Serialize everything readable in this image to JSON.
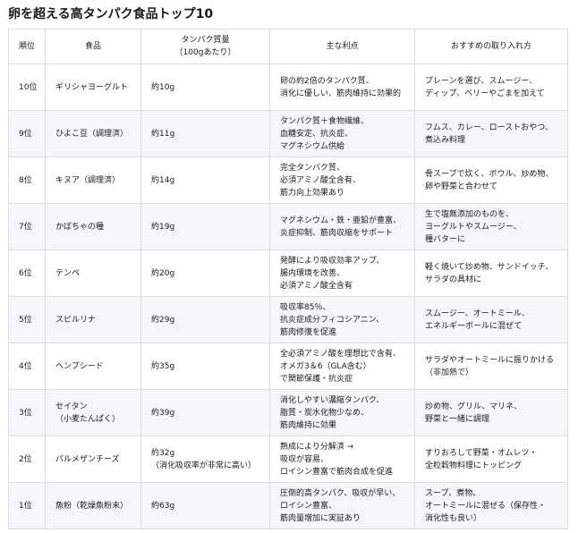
{
  "page": {
    "title": "卵を超える高タンパク食品トップ10"
  },
  "table": {
    "headers": [
      "順位",
      "食品",
      [
        "タンパク質量",
        "（100gあたり）"
      ],
      "主な利点",
      "おすすめの取り入れ方"
    ],
    "rows": [
      {
        "rank": "10位",
        "food": [
          "ギリシャヨーグルト"
        ],
        "protein": [
          "約10g"
        ],
        "benefits": [
          "卵の約2倍のタンパク質、",
          "消化に優しい、筋肉維持に効果的"
        ],
        "usage": [
          "プレーンを選び、スムージー、",
          "ディップ、ベリーやごまを加えて"
        ]
      },
      {
        "rank": "9位",
        "food": [
          "ひよこ豆（調理済）"
        ],
        "protein": [
          "約11g"
        ],
        "benefits": [
          "タンパク質＋食物繊維、",
          "血糖安定、抗炎症、",
          "マグネシウム供給"
        ],
        "usage": [
          "フムス、カレー、ローストおやつ、",
          "煮込み料理"
        ]
      },
      {
        "rank": "8位",
        "food": [
          "キヌア（調理済）"
        ],
        "protein": [
          "約14g"
        ],
        "benefits": [
          "完全タンパク質、",
          "必須アミノ酸全含有、",
          "筋力向上効果あり"
        ],
        "usage": [
          "骨スープで炊く、ボウル、炒め物、",
          "卵や野菜と合わせて"
        ]
      },
      {
        "rank": "7位",
        "food": [
          "かぼちゃの種"
        ],
        "protein": [
          "約19g"
        ],
        "benefits": [
          "マグネシウム・鉄・亜鉛が豊富、",
          "炎症抑制、筋肉収縮をサポート"
        ],
        "usage": [
          "生で塩無添加のものを、",
          "ヨーグルトやスムージー、",
          "種バターに"
        ]
      },
      {
        "rank": "6位",
        "food": [
          "テンペ"
        ],
        "protein": [
          "約20g"
        ],
        "benefits": [
          "発酵により吸収効率アップ、",
          "腸内環境を改善、",
          "必須アミノ酸全含有"
        ],
        "usage": [
          "軽く焼いて炒め物、サンドイッチ、",
          "サラダの具材に"
        ]
      },
      {
        "rank": "5位",
        "food": [
          "スピルリナ"
        ],
        "protein": [
          "約29g"
        ],
        "benefits": [
          "吸収率85％、",
          "抗炎症成分フィコシアニン、",
          "筋肉修復を促進"
        ],
        "usage": [
          "スムージー、オートミール、",
          "エネルギーボールに混ぜて"
        ]
      },
      {
        "rank": "4位",
        "food": [
          "ヘンプシード"
        ],
        "protein": [
          "約35g"
        ],
        "benefits": [
          "全必須アミノ酸を理想比で含有、",
          "オメガ3＆6（GLA含む）",
          "で関節保護・抗炎症"
        ],
        "usage": [
          "サラダやオートミールに振りかける",
          "（非加熱で）"
        ]
      },
      {
        "rank": "3位",
        "food": [
          "セイタン",
          "（小麦たんぱく）"
        ],
        "protein": [
          "約39g"
        ],
        "benefits": [
          "消化しやすい濃縮タンパク、",
          "脂質・炭水化物少なめ、",
          "筋肉維持に効果"
        ],
        "usage": [
          "炒め物、グリル、マリネ、",
          "野菜と一緒に調理"
        ]
      },
      {
        "rank": "2位",
        "food": [
          "パルメザンチーズ"
        ],
        "protein": [
          "約32g",
          "（消化吸収率が非常に高い）"
        ],
        "benefits": [
          "熟成により分解済 →",
          "吸収が容易、",
          "ロイシン豊富で筋肉合成を促進"
        ],
        "usage": [
          "すりおろして野菜・オムレツ・",
          "全粒穀物料理にトッピング"
        ]
      },
      {
        "rank": "1位",
        "food": [
          "魚粉（乾燥魚粉末）"
        ],
        "protein": [
          "約63g"
        ],
        "benefits": [
          "圧倒的高タンパク、吸収が早い、",
          "ロイシン豊富、",
          "筋肉量増加に実証あり"
        ],
        "usage": [
          "スープ、煮物、",
          "オートミールに混ぜる（保存性・",
          "消化性も良い）"
        ]
      }
    ]
  }
}
